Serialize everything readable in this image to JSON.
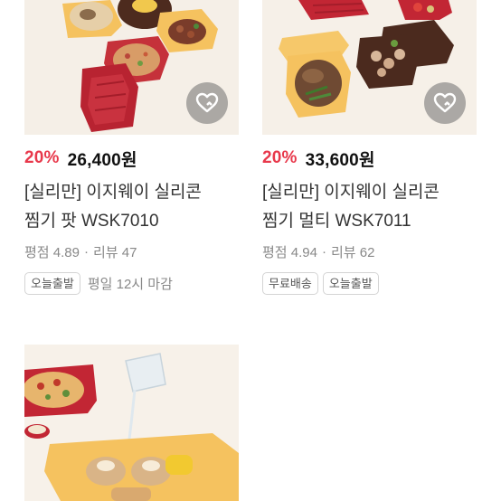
{
  "products": [
    {
      "discount": "20%",
      "price": "26,400원",
      "title_line1": "[실리만] 이지웨이 실리콘",
      "title_line2": "찜기 팟 WSK7010",
      "rating_label": "평점 4.89",
      "review_label": "리뷰 47",
      "tags": [
        "오늘출발"
      ],
      "deadline": "평일 12시 마감"
    },
    {
      "discount": "20%",
      "price": "33,600원",
      "title_line1": "[실리만] 이지웨이 실리콘",
      "title_line2": "찜기 멀티 WSK7011",
      "rating_label": "평점 4.94",
      "review_label": "리뷰 62",
      "tags": [
        "무료배송",
        "오늘출발"
      ]
    }
  ],
  "separator": "·",
  "icons": {
    "wishlist": "heart-outline-icon"
  },
  "colors": {
    "discount": "#e8384b",
    "accent_red": "#b8242f",
    "accent_yellow": "#f6c86a"
  }
}
